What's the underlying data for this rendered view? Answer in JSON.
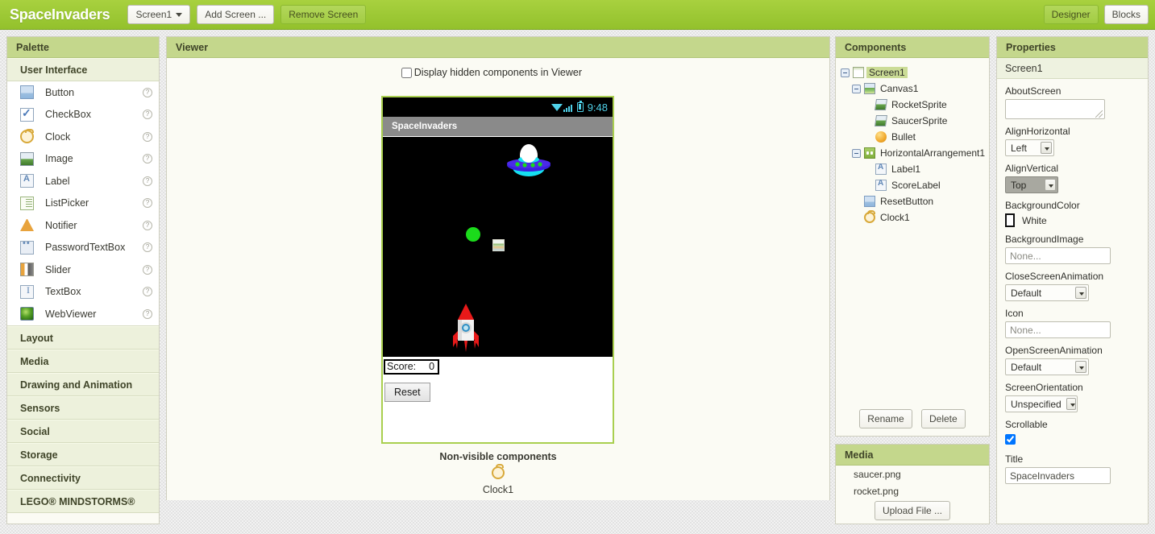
{
  "topbar": {
    "app_title": "SpaceInvaders",
    "screen_select": "Screen1",
    "add_screen": "Add Screen ...",
    "remove_screen": "Remove Screen",
    "designer": "Designer",
    "blocks": "Blocks",
    "accent_green": "#a8d13f"
  },
  "palette": {
    "title": "Palette",
    "open_section": "User Interface",
    "items": [
      {
        "label": "Button",
        "icon": "button-icon"
      },
      {
        "label": "CheckBox",
        "icon": "checkbox-icon"
      },
      {
        "label": "Clock",
        "icon": "clock-icon"
      },
      {
        "label": "Image",
        "icon": "image-icon"
      },
      {
        "label": "Label",
        "icon": "label-icon"
      },
      {
        "label": "ListPicker",
        "icon": "listpicker-icon"
      },
      {
        "label": "Notifier",
        "icon": "notifier-icon"
      },
      {
        "label": "PasswordTextBox",
        "icon": "password-icon"
      },
      {
        "label": "Slider",
        "icon": "slider-icon"
      },
      {
        "label": "TextBox",
        "icon": "textbox-icon"
      },
      {
        "label": "WebViewer",
        "icon": "webviewer-icon"
      }
    ],
    "help_glyph": "?",
    "sections": [
      "Layout",
      "Media",
      "Drawing and Animation",
      "Sensors",
      "Social",
      "Storage",
      "Connectivity",
      "LEGO® MINDSTORMS®"
    ]
  },
  "viewer": {
    "title": "Viewer",
    "hidden_components_label": "Display hidden components in Viewer",
    "hidden_components_checked": false,
    "phone": {
      "status_time": "9:48",
      "status_icons": [
        "wifi-icon",
        "signal-icon",
        "battery-icon"
      ],
      "title": "SpaceInvaders",
      "canvas_background": "#000000",
      "sprites": [
        {
          "name": "SaucerSprite",
          "kind": "saucer"
        },
        {
          "name": "Bullet",
          "kind": "ball",
          "color": "#1bdb1b"
        },
        {
          "name": "RocketSprite",
          "kind": "rocket"
        }
      ],
      "score_label": "Score:",
      "score_value": "0",
      "reset_button": "Reset"
    },
    "nonvisible_title": "Non-visible components",
    "nonvisible_items": [
      {
        "label": "Clock1",
        "icon": "clock-icon"
      }
    ]
  },
  "components": {
    "title": "Components",
    "tree": [
      {
        "label": "Screen1",
        "icon": "screen-icon",
        "depth": 0,
        "expander": true,
        "selected": true
      },
      {
        "label": "Canvas1",
        "icon": "canvas-icon",
        "depth": 1,
        "expander": true,
        "selected": false
      },
      {
        "label": "RocketSprite",
        "icon": "sprite-icon",
        "depth": 2,
        "expander": false,
        "selected": false
      },
      {
        "label": "SaucerSprite",
        "icon": "sprite-icon",
        "depth": 2,
        "expander": false,
        "selected": false
      },
      {
        "label": "Bullet",
        "icon": "ball-icon",
        "depth": 2,
        "expander": false,
        "selected": false
      },
      {
        "label": "HorizontalArrangement1",
        "icon": "horizontal-arrangement-icon",
        "depth": 1,
        "expander": true,
        "selected": false
      },
      {
        "label": "Label1",
        "icon": "label-icon",
        "depth": 2,
        "expander": false,
        "selected": false
      },
      {
        "label": "ScoreLabel",
        "icon": "label-icon",
        "depth": 2,
        "expander": false,
        "selected": false
      },
      {
        "label": "ResetButton",
        "icon": "button-icon",
        "depth": 1,
        "expander": false,
        "selected": false
      },
      {
        "label": "Clock1",
        "icon": "clock-icon",
        "depth": 1,
        "expander": false,
        "selected": false
      }
    ],
    "rename_button": "Rename",
    "delete_button": "Delete"
  },
  "media": {
    "title": "Media",
    "files": [
      "saucer.png",
      "rocket.png"
    ],
    "upload_button": "Upload File ..."
  },
  "properties": {
    "title": "Properties",
    "target": "Screen1",
    "about_screen": {
      "name": "AboutScreen",
      "value": ""
    },
    "align_horizontal": {
      "name": "AlignHorizontal",
      "value": "Left"
    },
    "align_vertical": {
      "name": "AlignVertical",
      "value": "Top",
      "focused": true
    },
    "background_color": {
      "name": "BackgroundColor",
      "value": "White",
      "hex": "#ffffff"
    },
    "background_image": {
      "name": "BackgroundImage",
      "value": "None..."
    },
    "close_screen_animation": {
      "name": "CloseScreenAnimation",
      "value": "Default"
    },
    "icon": {
      "name": "Icon",
      "value": "None..."
    },
    "open_screen_animation": {
      "name": "OpenScreenAnimation",
      "value": "Default"
    },
    "screen_orientation": {
      "name": "ScreenOrientation",
      "value": "Unspecified"
    },
    "scrollable": {
      "name": "Scrollable",
      "checked": true
    },
    "title_prop": {
      "name": "Title",
      "value": "SpaceInvaders"
    }
  }
}
